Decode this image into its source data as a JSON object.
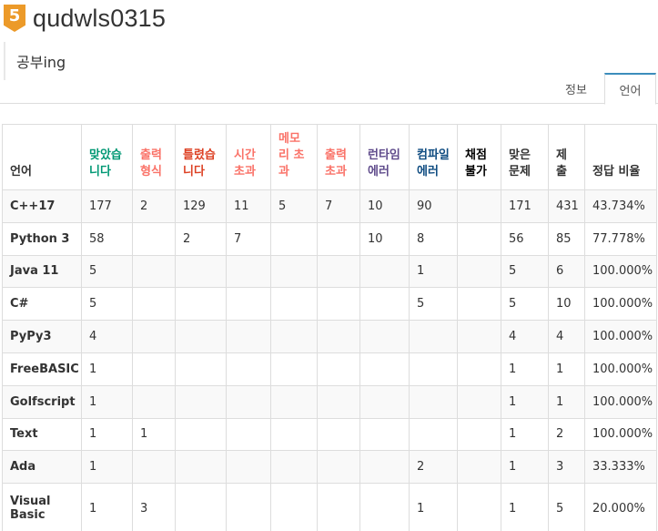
{
  "profile": {
    "rank_badge": "5",
    "username": "qudwls0315",
    "bio": "공부ing"
  },
  "tabs": [
    {
      "label": "정보",
      "active": false
    },
    {
      "label": "언어",
      "active": true
    }
  ],
  "colors": {
    "badge": "#ec9a29",
    "accepted": "#009874",
    "presentation_error": "#fa7268",
    "wrong_answer": "#dd4124",
    "runtime_error": "#5f4b8b",
    "compile_error": "#0f4c81",
    "tab_active_border": "#3c8dbc"
  },
  "table": {
    "headers": {
      "lang": "언어",
      "ac_1": "맞았습",
      "ac_2": "니다",
      "pe_1": "출력",
      "pe_2": "형식",
      "wa_1": "틀렸습",
      "wa_2": "니다",
      "tle_1": "시간",
      "tle_2": "초과",
      "mle_1": "메모",
      "mle_2": "리 초",
      "mle_3": "과",
      "ole_1": "출력",
      "ole_2": "초과",
      "rte_1": "런타임",
      "rte_2": "에러",
      "ce_1": "컴파일",
      "ce_2": "에러",
      "del_1": "채점",
      "del_2": "불가",
      "solved_1": "맞은",
      "solved_2": "문제",
      "submit_1": "제",
      "submit_2": "출",
      "ratio": "정답 비율"
    },
    "rows": [
      {
        "lang": "C++17",
        "ac": "177",
        "pe": "2",
        "wa": "129",
        "tle": "11",
        "mle": "5",
        "ole": "7",
        "rte": "10",
        "ce": "90",
        "del": "",
        "solved": "171",
        "submit": "431",
        "ratio": "43.734%"
      },
      {
        "lang": "Python 3",
        "ac": "58",
        "pe": "",
        "wa": "2",
        "tle": "7",
        "mle": "",
        "ole": "",
        "rte": "10",
        "ce": "8",
        "del": "",
        "solved": "56",
        "submit": "85",
        "ratio": "77.778%"
      },
      {
        "lang": "Java 11",
        "ac": "5",
        "pe": "",
        "wa": "",
        "tle": "",
        "mle": "",
        "ole": "",
        "rte": "",
        "ce": "1",
        "del": "",
        "solved": "5",
        "submit": "6",
        "ratio": "100.000%"
      },
      {
        "lang": "C#",
        "ac": "5",
        "pe": "",
        "wa": "",
        "tle": "",
        "mle": "",
        "ole": "",
        "rte": "",
        "ce": "5",
        "del": "",
        "solved": "5",
        "submit": "10",
        "ratio": "100.000%"
      },
      {
        "lang": "PyPy3",
        "ac": "4",
        "pe": "",
        "wa": "",
        "tle": "",
        "mle": "",
        "ole": "",
        "rte": "",
        "ce": "",
        "del": "",
        "solved": "4",
        "submit": "4",
        "ratio": "100.000%"
      },
      {
        "lang": "FreeBASIC",
        "ac": "1",
        "pe": "",
        "wa": "",
        "tle": "",
        "mle": "",
        "ole": "",
        "rte": "",
        "ce": "",
        "del": "",
        "solved": "1",
        "submit": "1",
        "ratio": "100.000%"
      },
      {
        "lang": "Golfscript",
        "ac": "1",
        "pe": "",
        "wa": "",
        "tle": "",
        "mle": "",
        "ole": "",
        "rte": "",
        "ce": "",
        "del": "",
        "solved": "1",
        "submit": "1",
        "ratio": "100.000%"
      },
      {
        "lang": "Text",
        "ac": "1",
        "pe": "1",
        "wa": "",
        "tle": "",
        "mle": "",
        "ole": "",
        "rte": "",
        "ce": "",
        "del": "",
        "solved": "1",
        "submit": "2",
        "ratio": "100.000%"
      },
      {
        "lang": "Ada",
        "ac": "1",
        "pe": "",
        "wa": "",
        "tle": "",
        "mle": "",
        "ole": "",
        "rte": "",
        "ce": "2",
        "del": "",
        "solved": "1",
        "submit": "3",
        "ratio": "33.333%"
      },
      {
        "lang": "Visual Basic",
        "ac": "1",
        "pe": "3",
        "wa": "",
        "tle": "",
        "mle": "",
        "ole": "",
        "rte": "",
        "ce": "1",
        "del": "",
        "solved": "1",
        "submit": "5",
        "ratio": "20.000%"
      }
    ]
  }
}
